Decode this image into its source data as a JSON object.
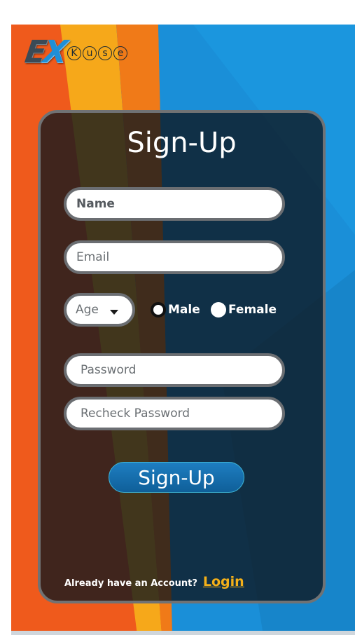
{
  "logo": {
    "ex_letters": [
      "E",
      "X"
    ],
    "circled_letters": [
      "K",
      "u",
      "s",
      "e"
    ]
  },
  "form": {
    "title": "Sign-Up",
    "name_placeholder": "Name",
    "email_placeholder": "Email",
    "age_placeholder": "Age",
    "gender": {
      "male_label": "Male",
      "female_label": "Female",
      "selected": "Male"
    },
    "password_placeholder": "Password",
    "recheck_placeholder": "Recheck Password",
    "submit_label": "Sign-Up"
  },
  "footer": {
    "question": "Already have an Account?",
    "login_label": "Login"
  },
  "colors": {
    "accent": "#1e7ec1",
    "link": "#f4b019",
    "card_border": "#707274",
    "bg_orange": "#ef5a1c",
    "bg_yellow": "#f6a81a",
    "bg_blue": "#1a8fd8"
  },
  "icons": {
    "age_dropdown": "chevron-down-icon",
    "male_radio": "radio-checked-icon",
    "female_radio": "radio-unchecked-icon"
  }
}
